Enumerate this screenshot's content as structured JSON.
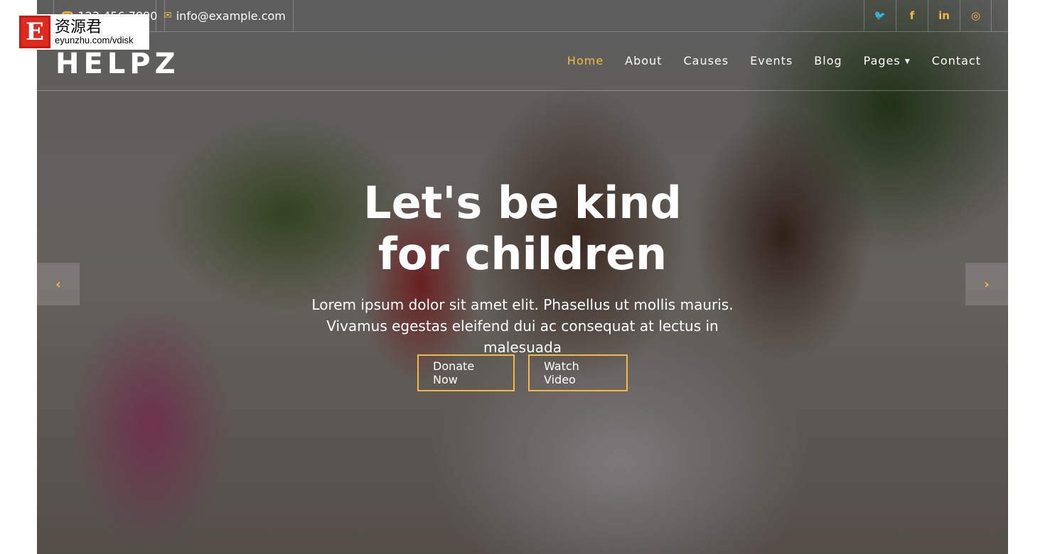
{
  "topbar": {
    "phone": "123 456 7890",
    "email": "info@example.com"
  },
  "social": [
    {
      "icon": "twitter-icon",
      "glyph": "🐦"
    },
    {
      "icon": "facebook-icon",
      "glyph": "f"
    },
    {
      "icon": "linkedin-icon",
      "glyph": "in"
    },
    {
      "icon": "instagram-icon",
      "glyph": "◎"
    }
  ],
  "brand": {
    "logo": "HELPZ"
  },
  "nav": {
    "items": [
      "Home",
      "About",
      "Causes",
      "Events",
      "Blog",
      "Pages",
      "Contact"
    ],
    "active": "Home"
  },
  "hero": {
    "title": "Let's be kind for children",
    "subtitle": "Lorem ipsum dolor sit amet elit. Phasellus ut mollis mauris. Vivamus egestas eleifend dui ac consequat at lectus in malesuada",
    "donate_label": "Donate Now",
    "video_label": "Watch Video"
  },
  "watermark": {
    "letter": "E",
    "cn": "资源君",
    "url": "eyunzhu.com/vdisk"
  },
  "colors": {
    "accent": "#f5b942"
  }
}
